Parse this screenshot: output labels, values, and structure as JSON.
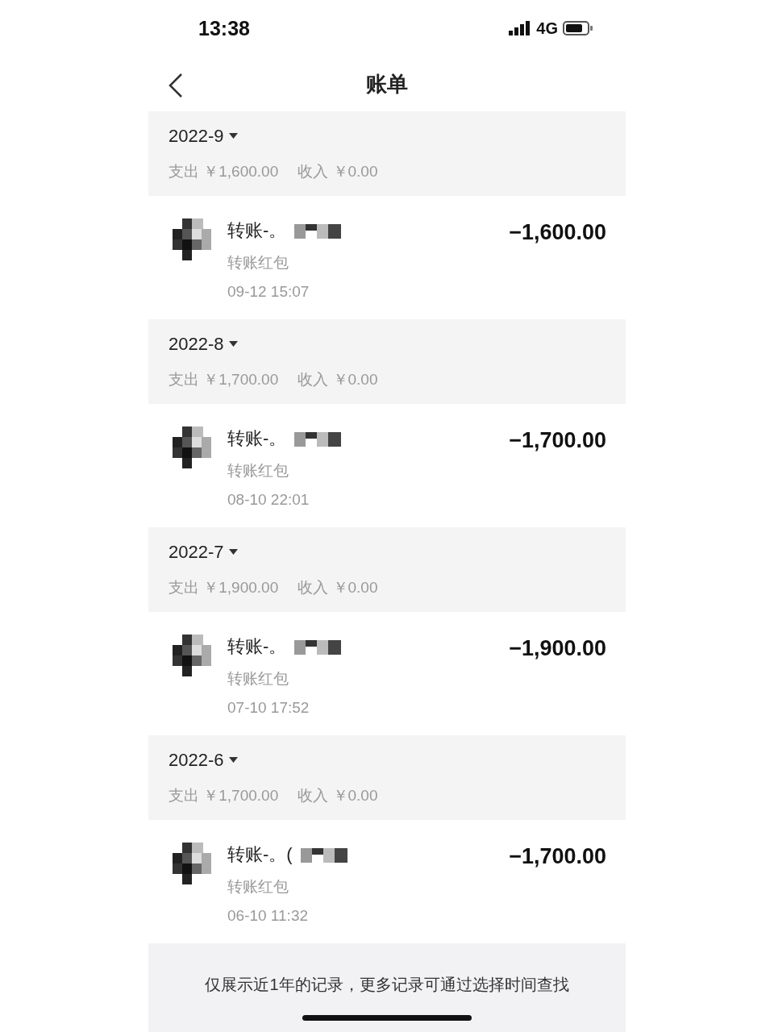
{
  "status_bar": {
    "time": "13:38",
    "network": "4G"
  },
  "nav": {
    "title": "账单"
  },
  "months": [
    {
      "month": "2022-9",
      "summary": "支出 ￥1,600.00",
      "income": "收入 ￥0.00",
      "records": [
        {
          "title": "转账-。",
          "type": "转账红包",
          "time": "09-12  15:07",
          "amount": "−1,600.00"
        }
      ]
    },
    {
      "month": "2022-8",
      "summary": "支出 ￥1,700.00",
      "income": "收入 ￥0.00",
      "records": [
        {
          "title": "转账-。",
          "type": "转账红包",
          "time": "08-10  22:01",
          "amount": "−1,700.00"
        }
      ]
    },
    {
      "month": "2022-7",
      "summary": "支出 ￥1,900.00",
      "income": "收入 ￥0.00",
      "records": [
        {
          "title": "转账-。",
          "type": "转账红包",
          "time": "07-10  17:52",
          "amount": "−1,900.00"
        }
      ]
    },
    {
      "month": "2022-6",
      "summary": "支出 ￥1,700.00",
      "income": "收入 ￥0.00",
      "records": [
        {
          "title": "转账-。(",
          "type": "转账红包",
          "time": "06-10  11:32",
          "amount": "−1,700.00"
        }
      ]
    }
  ],
  "footer_note": "仅展示近1年的记录，更多记录可通过选择时间查找"
}
